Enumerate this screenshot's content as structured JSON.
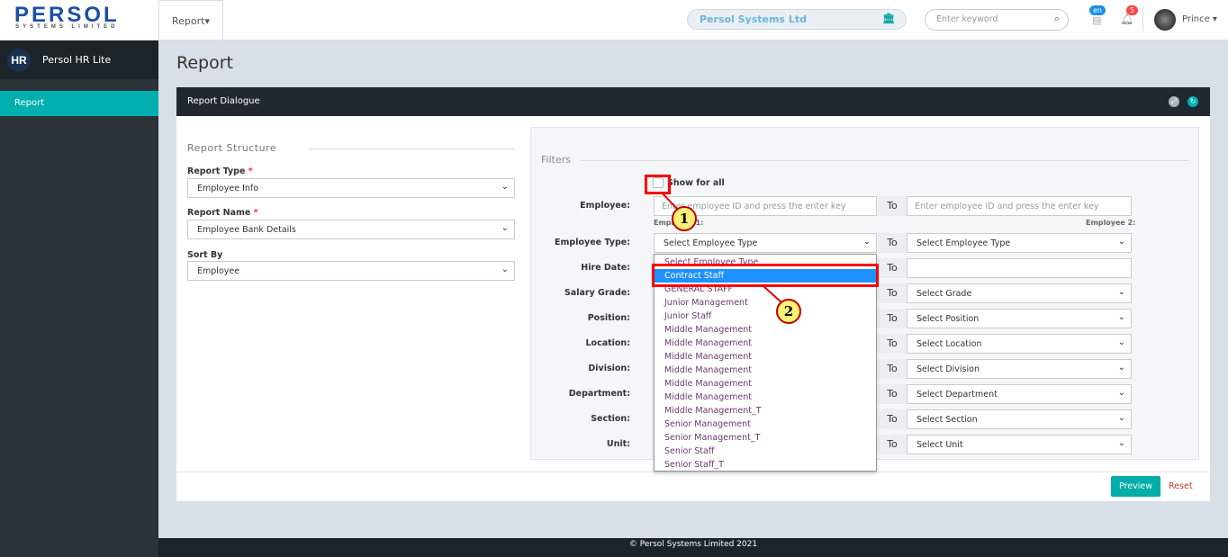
{
  "header": {
    "logo": "PERSOL",
    "logo_sub": "SYSTEMS LIMITED",
    "menu": "Report",
    "company": "Persol Systems Ltd",
    "search_placeholder": "Enter keyword",
    "lang": "en",
    "notifications": "5",
    "user": "Prince"
  },
  "sidebar": {
    "app": "Persol HR Lite",
    "badge": "HR",
    "items": [
      {
        "label": "Report"
      }
    ]
  },
  "page": {
    "title": "Report",
    "panel_title": "Report Dialogue"
  },
  "structure": {
    "heading": "Report Structure",
    "report_type_label": "Report Type",
    "report_type": "Employee Info",
    "report_name_label": "Report Name",
    "report_name": "Employee Bank Details",
    "sort_label": "Sort By",
    "sort": "Employee"
  },
  "filters": {
    "heading": "Filters",
    "show_all": "Show for all",
    "to": "To",
    "employee_label": "Employee:",
    "employee_placeholder": "Enter employee ID and press the enter key",
    "employee1_hint": "Employee 1:",
    "employee2_hint": "Employee 2:",
    "rows": [
      {
        "label": "Employee Type:",
        "right": "Select Employee Type"
      },
      {
        "label": "Hire Date:",
        "right": ""
      },
      {
        "label": "Salary Grade:",
        "right": "Select Grade"
      },
      {
        "label": "Position:",
        "right": "Select Position"
      },
      {
        "label": "Location:",
        "right": "Select Location"
      },
      {
        "label": "Division:",
        "right": "Select Division"
      },
      {
        "label": "Department:",
        "right": "Select Department"
      },
      {
        "label": "Section:",
        "right": "Select Section"
      },
      {
        "label": "Unit:",
        "right": "Select Unit"
      }
    ],
    "employee_type_value": "Select Employee Type",
    "options": [
      "Select Employee Type",
      "Contract Staff",
      "GENERAL STAFF",
      "Junior Management",
      "Junior Staff",
      "Middle Management",
      "Middle Management",
      "Middle Management",
      "Middle Management",
      "Middle Management",
      "Middle Management",
      "Middle Management_T",
      "Senior Management",
      "Senior Management_T",
      "Senior Staff",
      "Senior Staff_T"
    ],
    "highlighted": "Contract Staff"
  },
  "actions": {
    "preview": "Preview",
    "reset": "Reset"
  },
  "callouts": [
    "1",
    "2"
  ],
  "footer": "© Persol Systems Limited 2021",
  "colors": {
    "accent": "#00afb0",
    "highlight": "#1e90ff",
    "annotation": "#ff0000"
  }
}
